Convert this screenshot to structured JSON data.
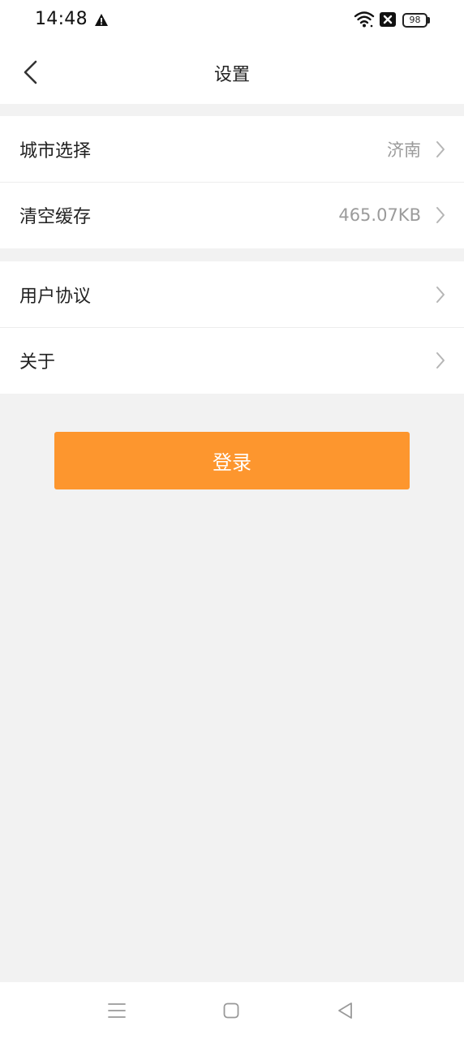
{
  "status_bar": {
    "time": "14:48",
    "battery": "98",
    "icons": [
      "warning-icon",
      "wifi-icon",
      "notification-x-icon",
      "battery-icon"
    ]
  },
  "header": {
    "title": "设置",
    "back_icon": "back-chevron-icon"
  },
  "groups": [
    {
      "rows": [
        {
          "label": "城市选择",
          "value": "济南"
        },
        {
          "label": "清空缓存",
          "value": "465.07KB"
        }
      ]
    },
    {
      "rows": [
        {
          "label": "用户协议",
          "value": ""
        },
        {
          "label": "关于",
          "value": ""
        }
      ]
    }
  ],
  "login_button": {
    "label": "登录"
  },
  "nav_bar": {
    "icons": [
      "menu-icon",
      "home-icon",
      "back-icon"
    ]
  },
  "colors": {
    "accent": "#fd962e",
    "background": "#f2f2f2",
    "row_value": "#9b9b9b"
  }
}
